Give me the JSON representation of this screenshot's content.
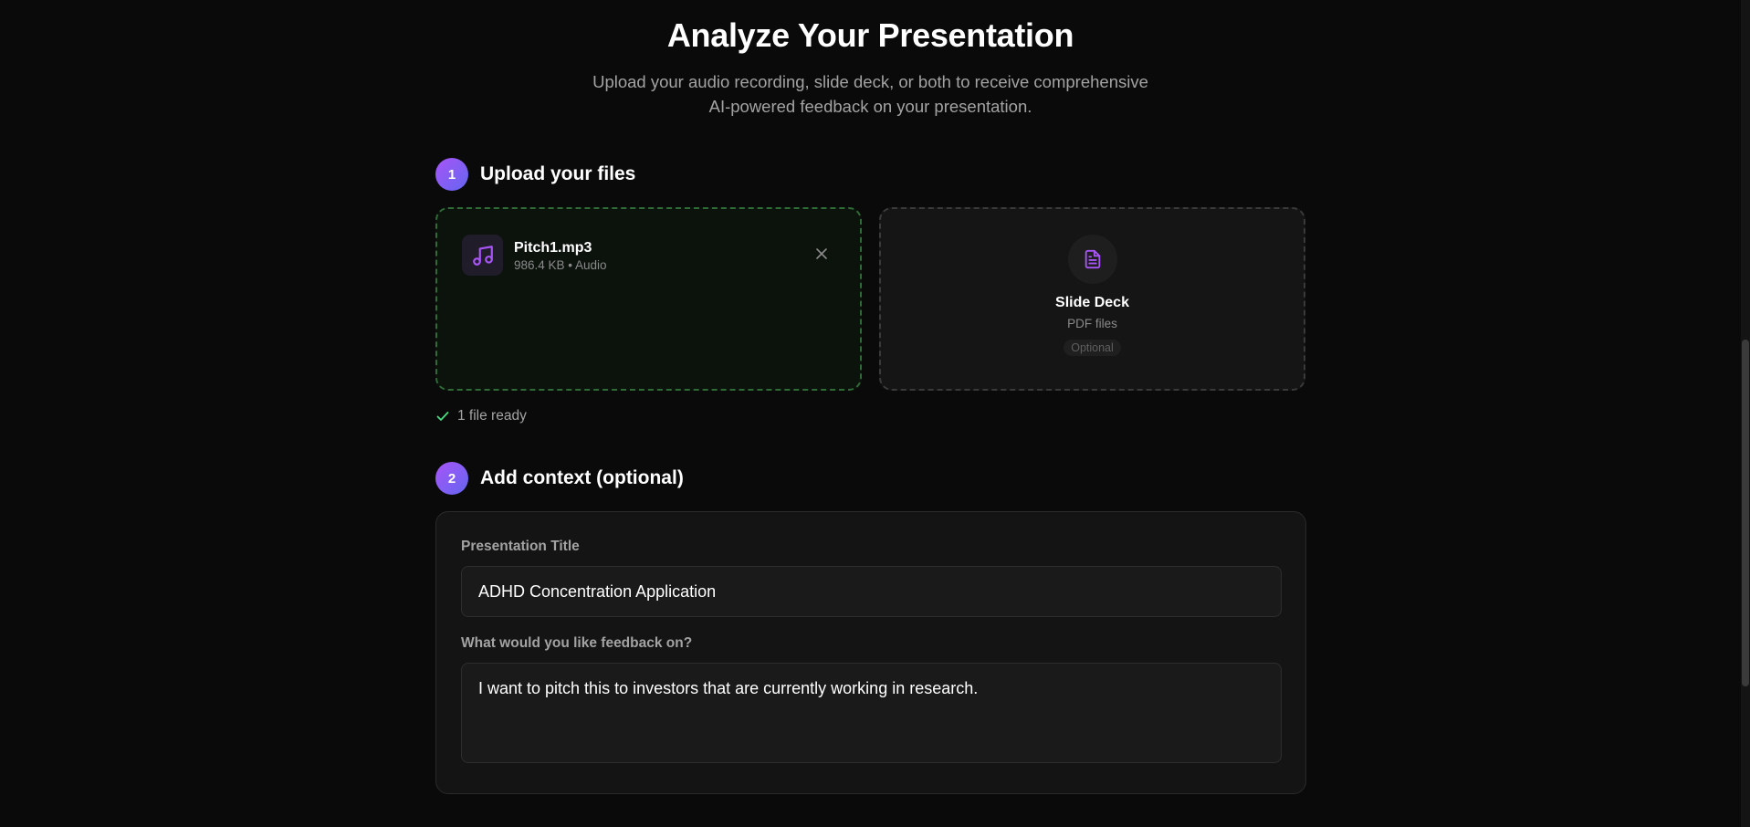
{
  "header": {
    "title": "Analyze Your Presentation",
    "subtitle_line1": "Upload your audio recording, slide deck, or both to receive comprehensive",
    "subtitle_line2": "AI-powered feedback on your presentation."
  },
  "step1": {
    "number": "1",
    "title": "Upload your files",
    "audio_file": {
      "name": "Pitch1.mp3",
      "meta": "986.4 KB • Audio",
      "icon": "music-note-icon"
    },
    "slide_deck": {
      "title": "Slide Deck",
      "subtitle": "PDF files",
      "badge": "Optional",
      "icon": "document-icon"
    },
    "status": "1 file ready"
  },
  "step2": {
    "number": "2",
    "title": "Add context (optional)",
    "title_label": "Presentation Title",
    "title_value": "ADHD Concentration Application",
    "feedback_label": "What would you like feedback on?",
    "feedback_value": "I want to pitch this to investors that are currently working in research."
  },
  "colors": {
    "accent_gradient_start": "#a855f7",
    "accent_gradient_end": "#6366f1",
    "success_border": "#2f6b36",
    "check_green": "#4ade80",
    "icon_purple": "#a855f7"
  }
}
